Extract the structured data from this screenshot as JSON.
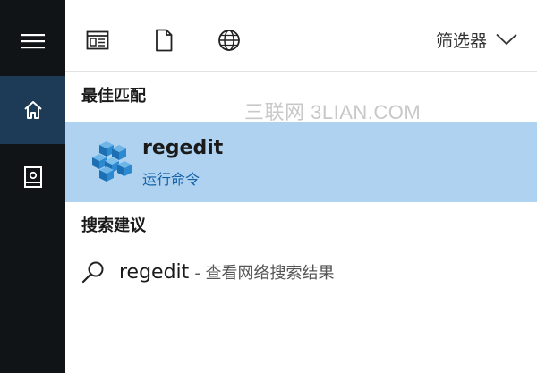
{
  "sidebar": {
    "menu_icon": "hamburger-icon",
    "home_icon": "home-icon",
    "notebook_icon": "notebook-icon",
    "active_color": "#1d3b57"
  },
  "toolbar": {
    "apps_icon": "apps-icon",
    "documents_icon": "document-icon",
    "web_icon": "globe-icon",
    "filter_label": "筛选器"
  },
  "watermark": "三联网 3LIAN.COM",
  "best_match": {
    "heading": "最佳匹配",
    "title": "regedit",
    "subtitle": "运行命令",
    "icon": "regedit-cubes-icon",
    "highlight_color": "#aed2f0"
  },
  "suggestions": {
    "heading": "搜索建议",
    "items": [
      {
        "query": "regedit",
        "description": "- 查看网络搜索结果",
        "icon": "search-icon"
      }
    ]
  }
}
